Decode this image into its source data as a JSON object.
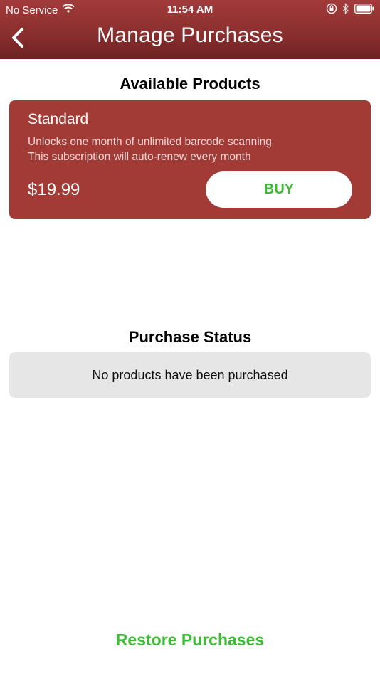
{
  "status_bar": {
    "carrier": "No Service",
    "time": "11:54 AM",
    "icons": [
      "wifi-icon",
      "orientation-lock-icon",
      "bluetooth-icon",
      "battery-icon"
    ]
  },
  "nav": {
    "title": "Manage Purchases",
    "back_icon": "chevron-left-icon"
  },
  "available": {
    "heading": "Available Products",
    "product": {
      "name": "Standard",
      "desc_line1": "Unlocks one month of unlimited barcode scanning",
      "desc_line2": "This subscription will auto-renew every month",
      "price": "$19.99",
      "buy_label": "BUY"
    }
  },
  "status": {
    "heading": "Purchase Status",
    "message": "No products have been purchased"
  },
  "restore_label": "Restore Purchases",
  "colors": {
    "header": "#8c2f2f",
    "card": "#a23a36",
    "accent_green": "#3dbb37",
    "status_box": "#e6e6e6"
  }
}
